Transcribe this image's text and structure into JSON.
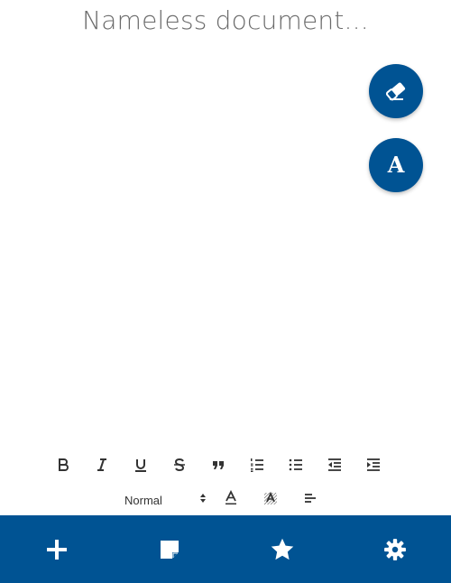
{
  "document": {
    "title": "Nameless document..."
  },
  "fabs": {
    "eraser_icon": "eraser-icon",
    "font_glyph": "A"
  },
  "toolbar": {
    "buttons": [
      "bold",
      "italic",
      "underline",
      "strikethrough",
      "blockquote",
      "ordered-list",
      "bullet-list",
      "outdent",
      "indent"
    ],
    "style_select_value": "Normal",
    "row2_buttons": [
      "font-color",
      "background-color",
      "align"
    ]
  },
  "bottom_nav": {
    "items": [
      "add",
      "note",
      "favorites",
      "settings"
    ]
  },
  "colors": {
    "primary": "#005393",
    "title": "#6b6b6b",
    "icon": "#333333"
  }
}
